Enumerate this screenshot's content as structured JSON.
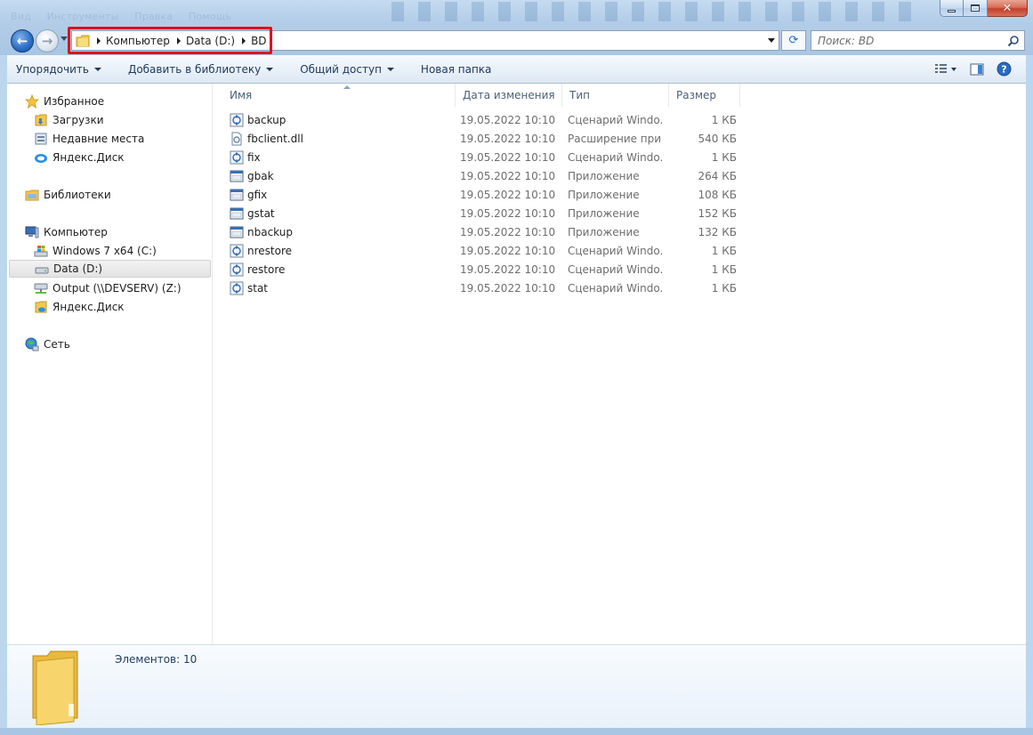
{
  "window": {
    "ghost_menu": [
      "Вид",
      "Инструменты",
      "Правка",
      "Помощь"
    ],
    "buttons": {
      "minimize": "minimize-icon",
      "maximize": "maximize-icon",
      "close": "✕"
    }
  },
  "address_bar": {
    "breadcrumbs": [
      "Компьютер",
      "Data (D:)",
      "BD"
    ],
    "refresh_glyph": "⟳"
  },
  "search": {
    "placeholder": "Поиск: BD"
  },
  "command_bar": {
    "organize": "Упорядочить",
    "add_to_library": "Добавить в библиотеку",
    "share": "Общий доступ",
    "new_folder": "Новая папка"
  },
  "nav_pane": {
    "favorites": "Избранное",
    "downloads": "Загрузки",
    "recent_places": "Недавние места",
    "yandex_disk_fav": "Яндекс.Диск",
    "libraries": "Библиотеки",
    "computer": "Компьютер",
    "drive_c": "Windows 7 x64 (C:)",
    "drive_d": "Data (D:)",
    "drive_z": "Output (\\\\DEVSERV) (Z:)",
    "yandex_disk": "Яндекс.Диск",
    "network": "Сеть"
  },
  "columns": {
    "name": "Имя",
    "date": "Дата изменения",
    "type": "Тип",
    "size": "Размер"
  },
  "files": [
    {
      "name": "backup",
      "date": "19.05.2022 10:10",
      "type": "Сценарий Windo...",
      "size": "1 КБ",
      "icon": "script-icon"
    },
    {
      "name": "fbclient.dll",
      "date": "19.05.2022 10:10",
      "type": "Расширение при...",
      "size": "540 КБ",
      "icon": "dll-icon"
    },
    {
      "name": "fix",
      "date": "19.05.2022 10:10",
      "type": "Сценарий Windo...",
      "size": "1 КБ",
      "icon": "script-icon"
    },
    {
      "name": "gbak",
      "date": "19.05.2022 10:10",
      "type": "Приложение",
      "size": "264 КБ",
      "icon": "app-icon"
    },
    {
      "name": "gfix",
      "date": "19.05.2022 10:10",
      "type": "Приложение",
      "size": "108 КБ",
      "icon": "app-icon"
    },
    {
      "name": "gstat",
      "date": "19.05.2022 10:10",
      "type": "Приложение",
      "size": "152 КБ",
      "icon": "app-icon"
    },
    {
      "name": "nbackup",
      "date": "19.05.2022 10:10",
      "type": "Приложение",
      "size": "132 КБ",
      "icon": "app-icon"
    },
    {
      "name": "nrestore",
      "date": "19.05.2022 10:10",
      "type": "Сценарий Windo...",
      "size": "1 КБ",
      "icon": "script-icon"
    },
    {
      "name": "restore",
      "date": "19.05.2022 10:10",
      "type": "Сценарий Windo...",
      "size": "1 КБ",
      "icon": "script-icon"
    },
    {
      "name": "stat",
      "date": "19.05.2022 10:10",
      "type": "Сценарий Windo...",
      "size": "1 КБ",
      "icon": "script-icon"
    }
  ],
  "details": {
    "item_count": "Элементов: 10"
  },
  "colors": {
    "highlight": "#e0101a",
    "accent": "#2a6cc4",
    "folder": "#f2c94c"
  }
}
